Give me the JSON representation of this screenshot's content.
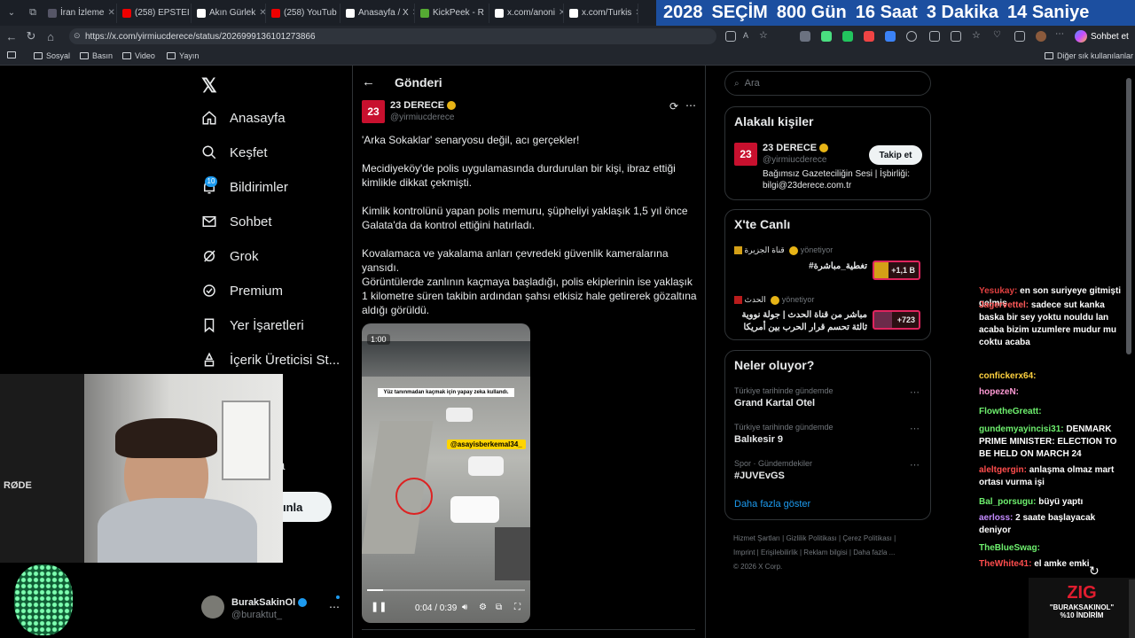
{
  "tabs": [
    {
      "label": "İran İzleme",
      "color": "#556"
    },
    {
      "label": "(258) EPSTEI",
      "color": "#e00"
    },
    {
      "label": "Akın Gürlek",
      "color": "#fff"
    },
    {
      "label": "(258) YouTub",
      "color": "#e00"
    },
    {
      "label": "Anasayfa / X",
      "color": "#fff"
    },
    {
      "label": "KickPeek - R",
      "color": "#5a3"
    },
    {
      "label": "x.com/anoni",
      "color": "#fff"
    },
    {
      "label": "x.com/Turkis",
      "color": "#fff"
    }
  ],
  "countdown": {
    "year": "2028",
    "label": "SEÇİM",
    "days": "800",
    "days_unit": "Gün",
    "hours": "16",
    "hours_unit": "Saat",
    "minutes": "3",
    "minutes_unit": "Dakika",
    "seconds": "14",
    "seconds_unit": "Saniye"
  },
  "browser": {
    "url": "https://x.com/yirmiucderece/status/2026999136101273866",
    "chat_label": "Sohbet et"
  },
  "bookmarks": {
    "items": [
      "Sosyal",
      "Basın",
      "Video",
      "Yayın"
    ],
    "other": "Diğer sık kullanılanlar"
  },
  "nav": {
    "items": [
      "Anasayfa",
      "Keşfet",
      "Bildirimler",
      "Sohbet",
      "Grok",
      "Premium",
      "Yer İşaretleri",
      "İçerik Üreticisi St..."
    ],
    "notif_badge": "10",
    "post_button_partial": "ınla",
    "partial_text": "a",
    "user": {
      "name": "BurakSakinOl",
      "handle": "@buraktut_"
    }
  },
  "post": {
    "header": "Gönderi",
    "author": "23 DERECE",
    "handle": "@yirmiucderece",
    "paragraphs": [
      "'Arka Sokaklar' senaryosu değil, acı gerçekler!",
      "Mecidiyeköy'de polis uygulamasında durdurulan bir kişi, ibraz ettiği kimlikle dikkat çekmişti.",
      "Kimlik kontrolünü yapan polis memuru, şüpheliyi yaklaşık 1,5 yıl önce Galata'da da kontrol ettiğini hatırladı.",
      "Kovalamaca ve yakalama anları çevredeki güvenlik kameralarına yansıdı.",
      "Görüntülerde zanlının kaçmaya başladığı, polis ekiplerinin ise yaklaşık 1 kilometre süren takibin ardından şahsı etkisiz hale getirerek gözaltına aldığı görüldü."
    ],
    "video": {
      "overlay_time": "1:00",
      "caption": "Yüz tanınmadan kaçmak için yapay zeka kullandı.",
      "tag": "@asayisberkemal34_",
      "time": "0:04 / 0:39",
      "progress": 0.1
    }
  },
  "search": {
    "placeholder": "Ara"
  },
  "relevant": {
    "title": "Alakalı kişiler",
    "name": "23 DERECE",
    "handle": "@yirmiucderece",
    "bio": "Bağımsız Gazeteciliğin Sesi | İşbirliği: bilgi@23derece.com.tr",
    "follow": "Takip et"
  },
  "live": {
    "title": "X'te Canlı",
    "items": [
      {
        "host": "قناة الجزيرة",
        "status": "yönetiyor",
        "title": "تغطية_مباشرة#",
        "count": "+1,1 B"
      },
      {
        "host": "الحدث",
        "status": "yönetiyor",
        "title": "مباشر من قناة الحدث | جولة نووية ثالثة تحسم قرار الحرب بين أمريكا ...",
        "count": "+723"
      }
    ]
  },
  "trends": {
    "title": "Neler oluyor?",
    "items": [
      {
        "context": "Türkiye tarihinde gündemde",
        "name": "Grand Kartal Otel"
      },
      {
        "context": "Türkiye tarihinde gündemde",
        "name": "Balıkesir 9"
      },
      {
        "context": "Spor · Gündemdekiler",
        "name": "#JUVEvGS"
      }
    ],
    "more": "Daha fazla göster"
  },
  "footer": {
    "links": [
      "Hizmet Şartları",
      "Gizlilik Politikası",
      "Çerez Politikası",
      "Imprint",
      "Erişilebilirlik",
      "Reklam bilgisi",
      "Daha fazla ..."
    ],
    "copyright": "© 2026 X Corp."
  },
  "chat": [
    {
      "user": "Yesukay:",
      "color": "#e04040",
      "msg": "en son suriyeye gitmişti gelmiş"
    },
    {
      "user": "Jagervettel:",
      "color": "#ff5a5a",
      "msg": "sadece sut kanka baska bir sey yoktu nouldu lan acaba bizim uzumlere mudur mu coktu acaba"
    },
    {
      "user": "confickerx64:",
      "color": "#ffd23f",
      "msg": ""
    },
    {
      "user": "hopezeN:",
      "color": "#ff9ad5",
      "msg": ""
    },
    {
      "user": "FlowtheGreatt:",
      "color": "#6ef06e",
      "msg": ""
    },
    {
      "user": "gundemyayincisi31:",
      "color": "#6ef06e",
      "msg": "DENMARK PRIME MINISTER: ELECTION TO BE HELD ON MARCH 24"
    },
    {
      "user": "aleltgergin:",
      "color": "#ff4d4d",
      "msg": "anlaşma olmaz mart ortası vurma işi"
    },
    {
      "user": "Bal_porsugu:",
      "color": "#6ef06e",
      "msg": "büyü yaptı"
    },
    {
      "user": "aerloss:",
      "color": "#c48bff",
      "msg": "2 saate başlayacak deniyor"
    },
    {
      "user": "TheBlueSwag:",
      "color": "#6ef06e",
      "msg": ""
    },
    {
      "user": "TheWhite41:",
      "color": "#ff4d4d",
      "msg": "el amke emki"
    }
  ],
  "promo": {
    "brand": "ZIG",
    "line1": "\"BURAKSAKINOL\"",
    "line2": "%10 İNDİRİM"
  },
  "webcam": {
    "brand": "RØDE"
  }
}
